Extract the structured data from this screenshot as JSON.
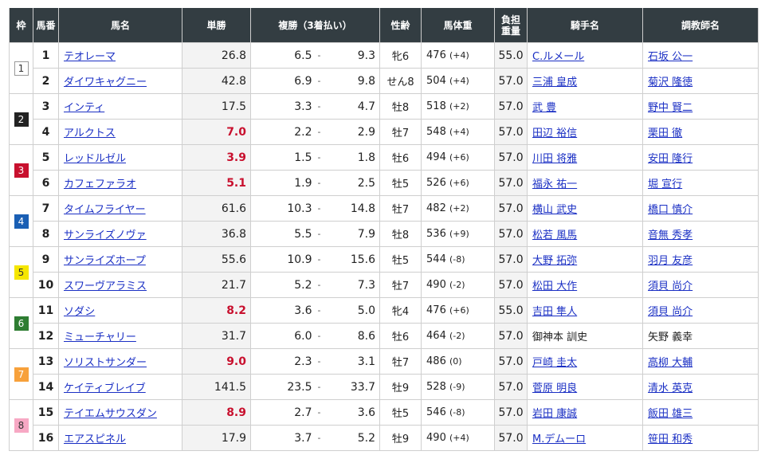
{
  "headers": {
    "waku": "枠",
    "umaban": "馬番",
    "name": "馬名",
    "tansho": "単勝",
    "fukusho": "複勝（3着払い）",
    "sexage": "性齢",
    "weight": "馬体重",
    "load_line1": "負担",
    "load_line2": "重量",
    "jockey": "騎手名",
    "trainer": "調教師名"
  },
  "waku_colors": {
    "1": {
      "bg": "#ffffff",
      "fg": "#333333",
      "border": "#999999"
    },
    "2": {
      "bg": "#222222",
      "fg": "#ffffff",
      "border": "#222222"
    },
    "3": {
      "bg": "#c8102e",
      "fg": "#ffffff",
      "border": "#c8102e"
    },
    "4": {
      "bg": "#1a5fb4",
      "fg": "#ffffff",
      "border": "#1a5fb4"
    },
    "5": {
      "bg": "#f5e600",
      "fg": "#333333",
      "border": "#f5e600"
    },
    "6": {
      "bg": "#2e7d32",
      "fg": "#ffffff",
      "border": "#2e7d32"
    },
    "7": {
      "bg": "#f7a13b",
      "fg": "#ffffff",
      "border": "#f7a13b"
    },
    "8": {
      "bg": "#f7a8c4",
      "fg": "#333333",
      "border": "#f7a8c4"
    }
  },
  "separator": "-",
  "rows": [
    {
      "waku": "1",
      "num": "1",
      "name": "テオレーマ",
      "tansho": "26.8",
      "fav": false,
      "fmin": "6.5",
      "fmax": "9.3",
      "sexage": "牝6",
      "weight": "476",
      "diff": "(+4)",
      "load": "55.0",
      "jockey": "C.ルメール",
      "jockey_link": true,
      "trainer": "石坂 公一",
      "trainer_link": true
    },
    {
      "waku": "1",
      "num": "2",
      "name": "ダイワキャグニー",
      "tansho": "42.8",
      "fav": false,
      "fmin": "6.9",
      "fmax": "9.8",
      "sexage": "せん8",
      "weight": "504",
      "diff": "(+4)",
      "load": "57.0",
      "jockey": "三浦 皇成",
      "jockey_link": true,
      "trainer": "菊沢 隆徳",
      "trainer_link": true
    },
    {
      "waku": "2",
      "num": "3",
      "name": "インティ",
      "tansho": "17.5",
      "fav": false,
      "fmin": "3.3",
      "fmax": "4.7",
      "sexage": "牡8",
      "weight": "518",
      "diff": "(+2)",
      "load": "57.0",
      "jockey": "武 豊",
      "jockey_link": true,
      "trainer": "野中 賢二",
      "trainer_link": true
    },
    {
      "waku": "2",
      "num": "4",
      "name": "アルクトス",
      "tansho": "7.0",
      "fav": true,
      "fmin": "2.2",
      "fmax": "2.9",
      "sexage": "牡7",
      "weight": "548",
      "diff": "(+4)",
      "load": "57.0",
      "jockey": "田辺 裕信",
      "jockey_link": true,
      "trainer": "栗田 徹",
      "trainer_link": true
    },
    {
      "waku": "3",
      "num": "5",
      "name": "レッドルゼル",
      "tansho": "3.9",
      "fav": true,
      "fmin": "1.5",
      "fmax": "1.8",
      "sexage": "牡6",
      "weight": "494",
      "diff": "(+6)",
      "load": "57.0",
      "jockey": "川田 将雅",
      "jockey_link": true,
      "trainer": "安田 隆行",
      "trainer_link": true
    },
    {
      "waku": "3",
      "num": "6",
      "name": "カフェファラオ",
      "tansho": "5.1",
      "fav": true,
      "fmin": "1.9",
      "fmax": "2.5",
      "sexage": "牡5",
      "weight": "526",
      "diff": "(+6)",
      "load": "57.0",
      "jockey": "福永 祐一",
      "jockey_link": true,
      "trainer": "堀 宣行",
      "trainer_link": true
    },
    {
      "waku": "4",
      "num": "7",
      "name": "タイムフライヤー",
      "tansho": "61.6",
      "fav": false,
      "fmin": "10.3",
      "fmax": "14.8",
      "sexage": "牡7",
      "weight": "482",
      "diff": "(+2)",
      "load": "57.0",
      "jockey": "横山 武史",
      "jockey_link": true,
      "trainer": "橋口 慎介",
      "trainer_link": true
    },
    {
      "waku": "4",
      "num": "8",
      "name": "サンライズノヴァ",
      "tansho": "36.8",
      "fav": false,
      "fmin": "5.5",
      "fmax": "7.9",
      "sexage": "牡8",
      "weight": "536",
      "diff": "(+9)",
      "load": "57.0",
      "jockey": "松若 風馬",
      "jockey_link": true,
      "trainer": "音無 秀孝",
      "trainer_link": true
    },
    {
      "waku": "5",
      "num": "9",
      "name": "サンライズホープ",
      "tansho": "55.6",
      "fav": false,
      "fmin": "10.9",
      "fmax": "15.6",
      "sexage": "牡5",
      "weight": "544",
      "diff": "(-8)",
      "load": "57.0",
      "jockey": "大野 拓弥",
      "jockey_link": true,
      "trainer": "羽月 友彦",
      "trainer_link": true
    },
    {
      "waku": "5",
      "num": "10",
      "name": "スワーヴアラミス",
      "tansho": "21.7",
      "fav": false,
      "fmin": "5.2",
      "fmax": "7.3",
      "sexage": "牡7",
      "weight": "490",
      "diff": "(-2)",
      "load": "57.0",
      "jockey": "松田 大作",
      "jockey_link": true,
      "trainer": "須貝 尚介",
      "trainer_link": true
    },
    {
      "waku": "6",
      "num": "11",
      "name": "ソダシ",
      "tansho": "8.2",
      "fav": true,
      "fmin": "3.6",
      "fmax": "5.0",
      "sexage": "牝4",
      "weight": "476",
      "diff": "(+6)",
      "load": "55.0",
      "jockey": "吉田 隼人",
      "jockey_link": true,
      "trainer": "須貝 尚介",
      "trainer_link": true
    },
    {
      "waku": "6",
      "num": "12",
      "name": "ミューチャリー",
      "tansho": "31.7",
      "fav": false,
      "fmin": "6.0",
      "fmax": "8.6",
      "sexage": "牡6",
      "weight": "464",
      "diff": "(-2)",
      "load": "57.0",
      "jockey": "御神本 訓史",
      "jockey_link": false,
      "trainer": "矢野 義幸",
      "trainer_link": false
    },
    {
      "waku": "7",
      "num": "13",
      "name": "ソリストサンダー",
      "tansho": "9.0",
      "fav": true,
      "fmin": "2.3",
      "fmax": "3.1",
      "sexage": "牡7",
      "weight": "486",
      "diff": "(0)",
      "load": "57.0",
      "jockey": "戸崎 圭太",
      "jockey_link": true,
      "trainer": "高柳 大輔",
      "trainer_link": true
    },
    {
      "waku": "7",
      "num": "14",
      "name": "ケイティブレイブ",
      "tansho": "141.5",
      "fav": false,
      "fmin": "23.5",
      "fmax": "33.7",
      "sexage": "牡9",
      "weight": "528",
      "diff": "(-9)",
      "load": "57.0",
      "jockey": "菅原 明良",
      "jockey_link": true,
      "trainer": "清水 英克",
      "trainer_link": true
    },
    {
      "waku": "8",
      "num": "15",
      "name": "テイエムサウスダン",
      "tansho": "8.9",
      "fav": true,
      "fmin": "2.7",
      "fmax": "3.6",
      "sexage": "牡5",
      "weight": "546",
      "diff": "(-8)",
      "load": "57.0",
      "jockey": "岩田 康誠",
      "jockey_link": true,
      "trainer": "飯田 雄三",
      "trainer_link": true
    },
    {
      "waku": "8",
      "num": "16",
      "name": "エアスピネル",
      "tansho": "17.9",
      "fav": false,
      "fmin": "3.7",
      "fmax": "5.2",
      "sexage": "牡9",
      "weight": "490",
      "diff": "(+4)",
      "load": "57.0",
      "jockey": "M.デムーロ",
      "jockey_link": true,
      "trainer": "笹田 和秀",
      "trainer_link": true
    }
  ]
}
